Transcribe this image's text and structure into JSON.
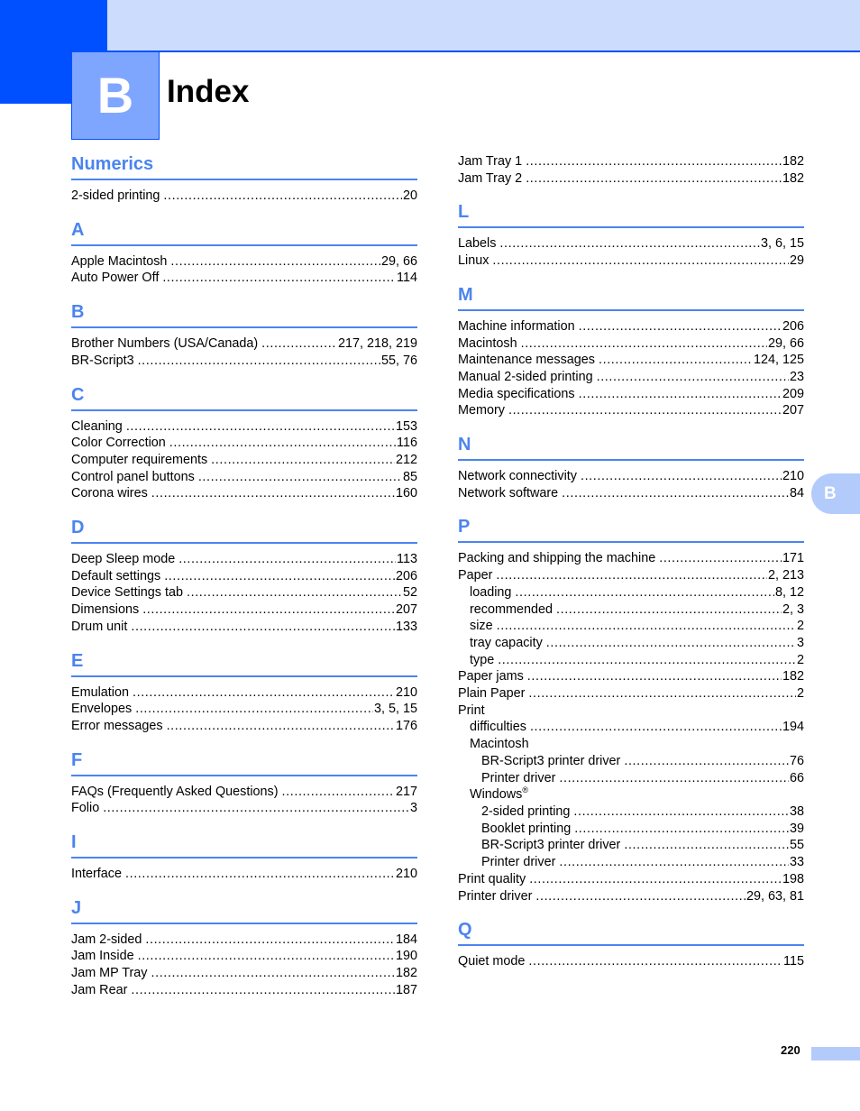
{
  "header": {
    "chapter_letter": "B",
    "title": "Index"
  },
  "side_tab": {
    "label": "B"
  },
  "footer": {
    "page_number": "220"
  },
  "colors": {
    "accent_dark": "#0050ff",
    "accent_band": "#ccdcfc",
    "heading_blue": "#4b84ef",
    "tab_light": "#b3cbfb"
  },
  "left_column": [
    {
      "heading": "Numerics",
      "entries": [
        {
          "label": "2-sided printing",
          "pages": "20",
          "level": 0
        }
      ]
    },
    {
      "heading": "A",
      "entries": [
        {
          "label": "Apple Macintosh",
          "pages": "29, 66",
          "level": 0
        },
        {
          "label": "Auto Power Off",
          "pages": "114",
          "level": 0
        }
      ]
    },
    {
      "heading": "B",
      "entries": [
        {
          "label": "Brother Numbers (USA/Canada)",
          "pages": "217, 218, 219",
          "level": 0
        },
        {
          "label": "BR-Script3",
          "pages": "55, 76",
          "level": 0
        }
      ]
    },
    {
      "heading": "C",
      "entries": [
        {
          "label": "Cleaning",
          "pages": "153",
          "level": 0
        },
        {
          "label": "Color Correction",
          "pages": "116",
          "level": 0
        },
        {
          "label": "Computer requirements",
          "pages": "212",
          "level": 0
        },
        {
          "label": "Control panel buttons",
          "pages": "85",
          "level": 0
        },
        {
          "label": "Corona wires",
          "pages": "160",
          "level": 0
        }
      ]
    },
    {
      "heading": "D",
      "entries": [
        {
          "label": "Deep Sleep mode",
          "pages": "113",
          "level": 0
        },
        {
          "label": "Default settings",
          "pages": "206",
          "level": 0
        },
        {
          "label": "Device Settings tab",
          "pages": "52",
          "level": 0
        },
        {
          "label": "Dimensions",
          "pages": "207",
          "level": 0
        },
        {
          "label": "Drum unit",
          "pages": "133",
          "level": 0
        }
      ]
    },
    {
      "heading": "E",
      "entries": [
        {
          "label": "Emulation",
          "pages": "210",
          "level": 0
        },
        {
          "label": "Envelopes",
          "pages": "3, 5, 15",
          "level": 0
        },
        {
          "label": "Error messages",
          "pages": "176",
          "level": 0
        }
      ]
    },
    {
      "heading": "F",
      "entries": [
        {
          "label": "FAQs (Frequently Asked Questions)",
          "pages": "217",
          "level": 0
        },
        {
          "label": "Folio",
          "pages": "3",
          "level": 0
        }
      ]
    },
    {
      "heading": "I",
      "entries": [
        {
          "label": "Interface",
          "pages": "210",
          "level": 0
        }
      ]
    },
    {
      "heading": "J",
      "entries": [
        {
          "label": "Jam 2-sided",
          "pages": "184",
          "level": 0
        },
        {
          "label": "Jam Inside",
          "pages": "190",
          "level": 0
        },
        {
          "label": "Jam MP Tray",
          "pages": "182",
          "level": 0
        },
        {
          "label": "Jam Rear",
          "pages": "187",
          "level": 0
        }
      ]
    }
  ],
  "right_column": [
    {
      "heading": "",
      "entries": [
        {
          "label": "Jam Tray 1",
          "pages": "182",
          "level": 0
        },
        {
          "label": "Jam Tray 2",
          "pages": "182",
          "level": 0
        }
      ]
    },
    {
      "heading": "L",
      "entries": [
        {
          "label": "Labels",
          "pages": "3, 6, 15",
          "level": 0
        },
        {
          "label": "Linux",
          "pages": "29",
          "level": 0
        }
      ]
    },
    {
      "heading": "M",
      "entries": [
        {
          "label": "Machine information",
          "pages": "206",
          "level": 0
        },
        {
          "label": "Macintosh",
          "pages": "29, 66",
          "level": 0
        },
        {
          "label": "Maintenance messages",
          "pages": "124, 125",
          "level": 0
        },
        {
          "label": "Manual 2-sided printing",
          "pages": "23",
          "level": 0
        },
        {
          "label": "Media specifications",
          "pages": "209",
          "level": 0
        },
        {
          "label": "Memory",
          "pages": "207",
          "level": 0
        }
      ]
    },
    {
      "heading": "N",
      "entries": [
        {
          "label": "Network connectivity",
          "pages": "210",
          "level": 0
        },
        {
          "label": "Network software",
          "pages": "84",
          "level": 0
        }
      ]
    },
    {
      "heading": "P",
      "entries": [
        {
          "label": "Packing and shipping the machine",
          "pages": "171",
          "level": 0
        },
        {
          "label": "Paper",
          "pages": "2, 213",
          "level": 0
        },
        {
          "label": "loading",
          "pages": "8, 12",
          "level": 1
        },
        {
          "label": "recommended",
          "pages": "2, 3",
          "level": 1
        },
        {
          "label": "size",
          "pages": "2",
          "level": 1
        },
        {
          "label": "tray capacity",
          "pages": "3",
          "level": 1
        },
        {
          "label": "type",
          "pages": "2",
          "level": 1
        },
        {
          "label": "Paper jams",
          "pages": "182",
          "level": 0
        },
        {
          "label": "Plain Paper",
          "pages": "2",
          "level": 0
        },
        {
          "label": "Print",
          "pages": "",
          "level": 0
        },
        {
          "label": "difficulties",
          "pages": "194",
          "level": 1
        },
        {
          "label": "Macintosh",
          "pages": "",
          "level": 1
        },
        {
          "label": "BR-Script3 printer driver",
          "pages": "76",
          "level": 2
        },
        {
          "label": "Printer driver",
          "pages": "66",
          "level": 2
        },
        {
          "label": "Windows",
          "sup": "®",
          "pages": "",
          "level": 1
        },
        {
          "label": "2-sided printing",
          "pages": "38",
          "level": 2
        },
        {
          "label": "Booklet printing",
          "pages": "39",
          "level": 2
        },
        {
          "label": "BR-Script3 printer driver",
          "pages": "55",
          "level": 2
        },
        {
          "label": "Printer driver",
          "pages": "33",
          "level": 2
        },
        {
          "label": "Print quality",
          "pages": "198",
          "level": 0
        },
        {
          "label": "Printer driver",
          "pages": "29, 63, 81",
          "level": 0
        }
      ]
    },
    {
      "heading": "Q",
      "entries": [
        {
          "label": "Quiet mode",
          "pages": "115",
          "level": 0
        }
      ]
    }
  ]
}
